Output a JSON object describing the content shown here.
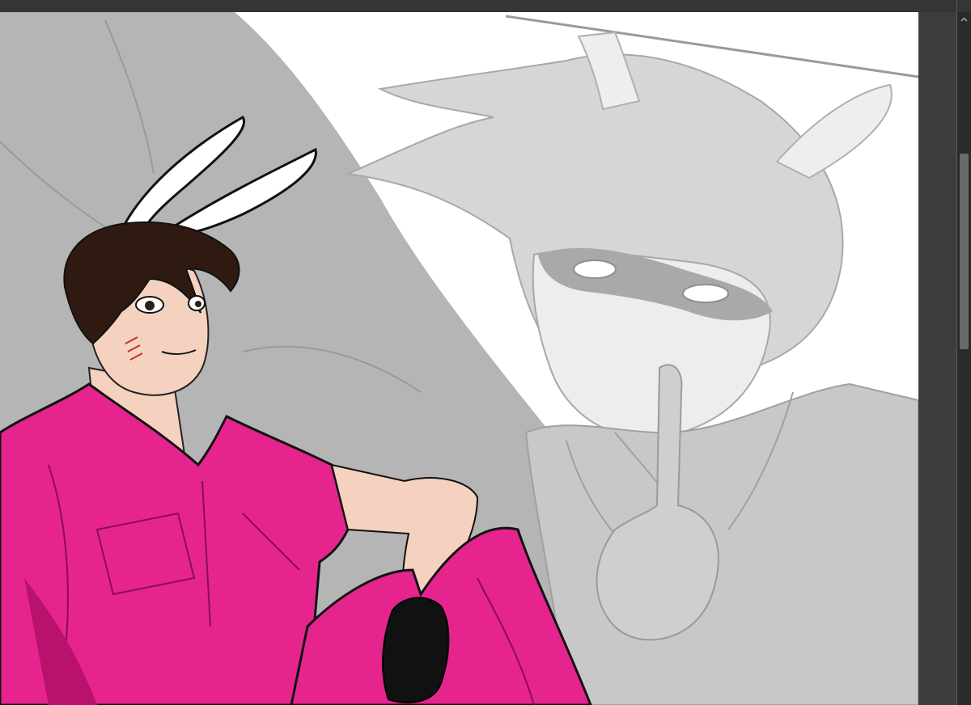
{
  "window": {
    "frame_color": "#3a3a3a",
    "top_bar_color": "#353535",
    "panel_color": "#3d3d3d"
  },
  "canvas": {
    "background_color": "#ffffff",
    "artwork": {
      "foreground_character": {
        "shirt_color": "#e6248e",
        "shirt_shadow_color": "#b8126c",
        "skin_color": "#f5d2c0",
        "hair_color": "#2f1a12",
        "glove_color": "#111111",
        "ear_color": "#ffffff"
      },
      "background_character": {
        "line_color": "#a8a8a8",
        "fill_color": "#d8d8d8",
        "cape_color": "#b5b5b5"
      }
    }
  },
  "scrollbar": {
    "orientation": "vertical",
    "arrow_icon": "chevron-up-icon",
    "position": 0.25,
    "thumb_color": "#6a6a6a"
  }
}
